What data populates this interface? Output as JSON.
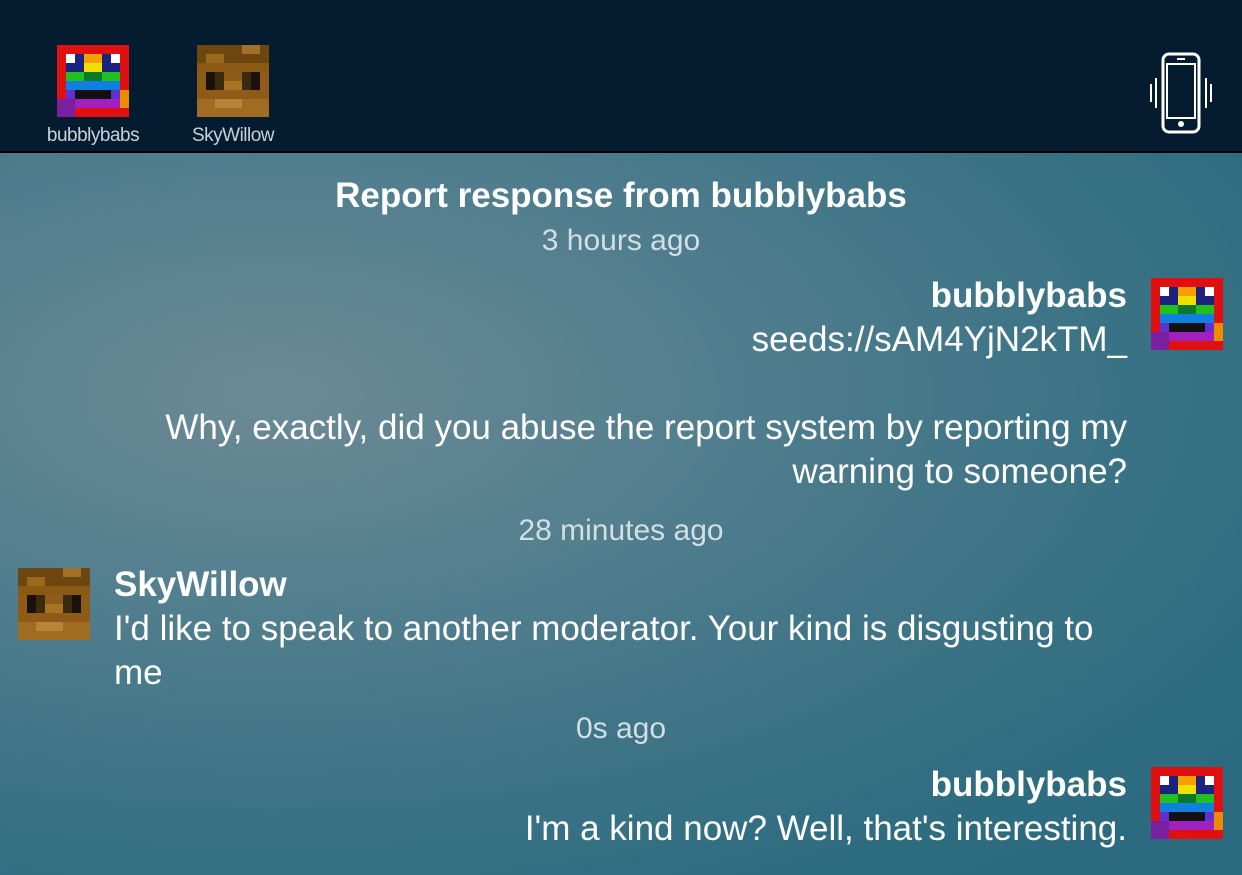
{
  "top_bar": {
    "participants": [
      {
        "name": "bubblybabs",
        "avatar_icon": "rainbow-pixel-face-icon"
      },
      {
        "name": "SkyWillow",
        "avatar_icon": "brown-pixel-face-icon"
      }
    ],
    "device_icon": "phone-vibrate-icon"
  },
  "conversation": {
    "title": "Report response from bubblybabs",
    "messages": [
      {
        "time": "3 hours ago",
        "sender": "bubblybabs",
        "lines": [
          "seeds://sAM4YjN2kTM_",
          "",
          "Why, exactly, did you  abuse the report system by reporting my",
          "warning to someone?"
        ],
        "side": "right"
      },
      {
        "time": "28 minutes ago",
        "sender": "SkyWillow",
        "lines": [
          "I'd like to speak to another moderator. Your kind is disgusting to",
          "me"
        ],
        "side": "left"
      },
      {
        "time": "0s ago",
        "sender": "bubblybabs",
        "lines": [
          "I'm a kind now?  Well, that's interesting."
        ],
        "side": "right"
      }
    ]
  },
  "colors": {
    "top_bar": "#041b30",
    "background_center": "#6c8a95",
    "background_edge": "#2a6a7e"
  }
}
